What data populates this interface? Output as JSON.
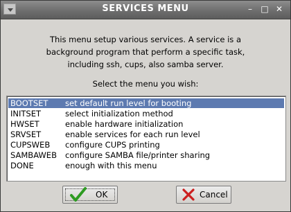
{
  "window": {
    "title": "SERVICES MENU",
    "controls": {
      "minimize": "–",
      "maximize": "□",
      "close": "✕"
    }
  },
  "description": [
    "This menu setup various services. A service is a",
    "background program that perform a specific task,",
    "including ssh, cups, also samba server."
  ],
  "prompt": "Select the menu you wish:",
  "menu": {
    "selected_index": 0,
    "items": [
      {
        "key": "BOOTSET",
        "desc": "set default run level for booting"
      },
      {
        "key": "INITSET",
        "desc": "select initialization method"
      },
      {
        "key": "HWSET",
        "desc": "enable hardware initialization"
      },
      {
        "key": "SRVSET",
        "desc": "enable services for each run level"
      },
      {
        "key": "CUPSWEB",
        "desc": "configure CUPS printing"
      },
      {
        "key": "SAMBAWEB",
        "desc": "configure SAMBA file/printer sharing"
      },
      {
        "key": "DONE",
        "desc": "enough with this menu"
      }
    ]
  },
  "buttons": {
    "ok": {
      "label": "OK",
      "icon": "checkmark-icon"
    },
    "cancel": {
      "label": "Cancel",
      "icon": "x-cross-icon"
    }
  },
  "colors": {
    "selection": "#5d7ab0",
    "ok_icon": "#2e9b22",
    "cancel_icon": "#cc1f1f"
  }
}
